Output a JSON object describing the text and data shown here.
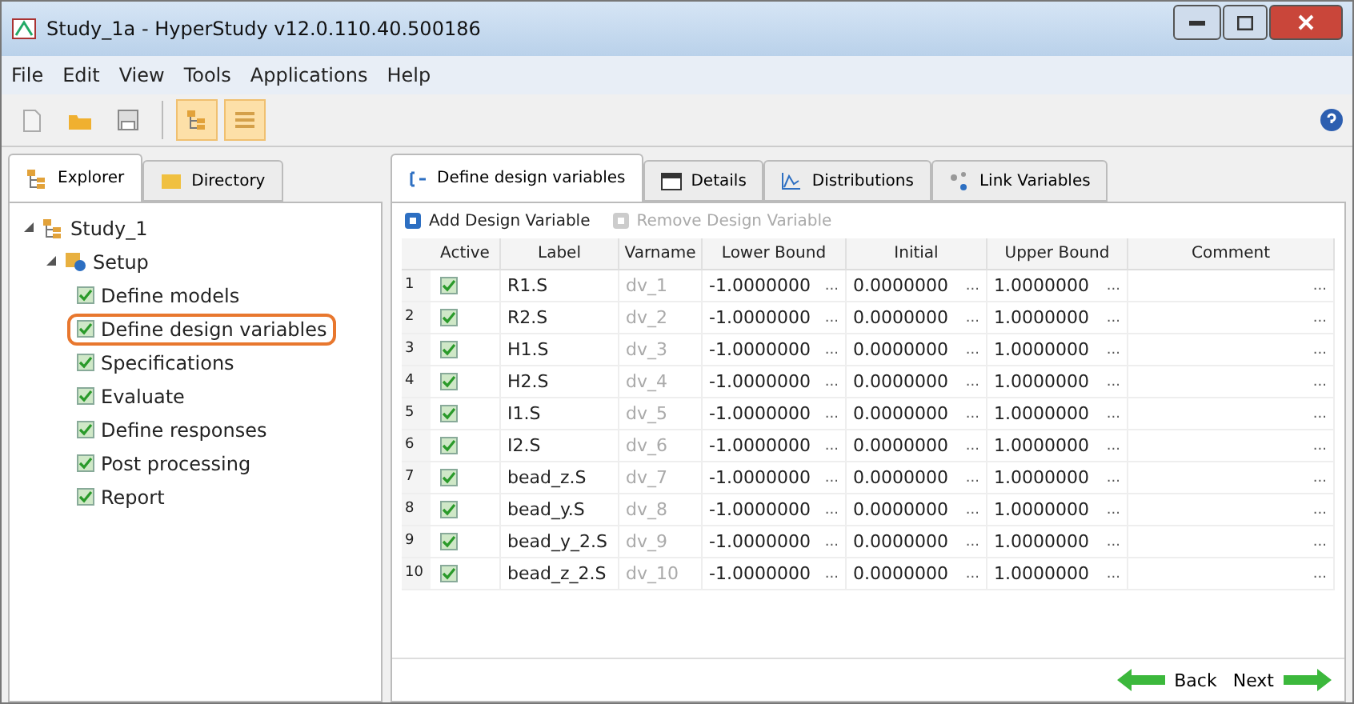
{
  "window": {
    "title": "Study_1a - HyperStudy v12.0.110.40.500186"
  },
  "menu": [
    "File",
    "Edit",
    "View",
    "Tools",
    "Applications",
    "Help"
  ],
  "toolbar": [
    {
      "kind": "new",
      "selected": false
    },
    {
      "kind": "open",
      "selected": false
    },
    {
      "kind": "save",
      "selected": false
    },
    {
      "kind": "tree",
      "selected": true
    },
    {
      "kind": "grid",
      "selected": true
    }
  ],
  "left_tabs": [
    {
      "label": "Explorer",
      "kind": "tree",
      "selected": true
    },
    {
      "label": "Directory",
      "kind": "folder",
      "selected": false
    }
  ],
  "tree": [
    {
      "label": "Study_1",
      "kind": "study",
      "expanded": true,
      "children": [
        {
          "label": "Setup",
          "kind": "setup",
          "expanded": true,
          "children": [
            {
              "label": "Define models",
              "kind": "step",
              "checked": true,
              "highlighted": false
            },
            {
              "label": "Define design variables",
              "kind": "step",
              "checked": true,
              "highlighted": true
            },
            {
              "label": "Specifications",
              "kind": "step",
              "checked": true,
              "highlighted": false
            },
            {
              "label": "Evaluate",
              "kind": "step",
              "checked": true,
              "highlighted": false
            },
            {
              "label": "Define responses",
              "kind": "step",
              "checked": true,
              "highlighted": false
            },
            {
              "label": "Post processing",
              "kind": "step",
              "checked": true,
              "highlighted": false
            },
            {
              "label": "Report",
              "kind": "step",
              "checked": true,
              "highlighted": false
            }
          ]
        }
      ]
    }
  ],
  "right_tabs": [
    {
      "label": "Define design variables",
      "kind": "vars",
      "selected": true
    },
    {
      "label": "Details",
      "kind": "details",
      "selected": false
    },
    {
      "label": "Distributions",
      "kind": "dist",
      "selected": false
    },
    {
      "label": "Link Variables",
      "kind": "link",
      "selected": false
    }
  ],
  "actions": [
    {
      "label": "Add Design Variable",
      "disabled": false
    },
    {
      "label": "Remove Design Variable",
      "disabled": true
    }
  ],
  "table": {
    "columns": [
      "Active",
      "Label",
      "Varname",
      "Lower Bound",
      "Initial",
      "Upper Bound",
      "Comment"
    ],
    "rows": [
      {
        "index": "1",
        "active": true,
        "label": "R1.S",
        "varname": "dv_1",
        "lower": "-1.0000000",
        "initial": "0.0000000",
        "upper": "1.0000000"
      },
      {
        "index": "2",
        "active": true,
        "label": "R2.S",
        "varname": "dv_2",
        "lower": "-1.0000000",
        "initial": "0.0000000",
        "upper": "1.0000000"
      },
      {
        "index": "3",
        "active": true,
        "label": "H1.S",
        "varname": "dv_3",
        "lower": "-1.0000000",
        "initial": "0.0000000",
        "upper": "1.0000000"
      },
      {
        "index": "4",
        "active": true,
        "label": "H2.S",
        "varname": "dv_4",
        "lower": "-1.0000000",
        "initial": "0.0000000",
        "upper": "1.0000000"
      },
      {
        "index": "5",
        "active": true,
        "label": "I1.S",
        "varname": "dv_5",
        "lower": "-1.0000000",
        "initial": "0.0000000",
        "upper": "1.0000000"
      },
      {
        "index": "6",
        "active": true,
        "label": "I2.S",
        "varname": "dv_6",
        "lower": "-1.0000000",
        "initial": "0.0000000",
        "upper": "1.0000000"
      },
      {
        "index": "7",
        "active": true,
        "label": "bead_z.S",
        "varname": "dv_7",
        "lower": "-1.0000000",
        "initial": "0.0000000",
        "upper": "1.0000000"
      },
      {
        "index": "8",
        "active": true,
        "label": "bead_y.S",
        "varname": "dv_8",
        "lower": "-1.0000000",
        "initial": "0.0000000",
        "upper": "1.0000000"
      },
      {
        "index": "9",
        "active": true,
        "label": "bead_y_2.S",
        "varname": "dv_9",
        "lower": "-1.0000000",
        "initial": "0.0000000",
        "upper": "1.0000000"
      },
      {
        "index": "10",
        "active": true,
        "label": "bead_z_2.S",
        "varname": "dv_10",
        "lower": "-1.0000000",
        "initial": "0.0000000",
        "upper": "1.0000000"
      }
    ],
    "more": "..."
  },
  "nav": [
    {
      "label": "Back",
      "kind": "back"
    },
    {
      "label": "Next",
      "kind": "next"
    }
  ]
}
